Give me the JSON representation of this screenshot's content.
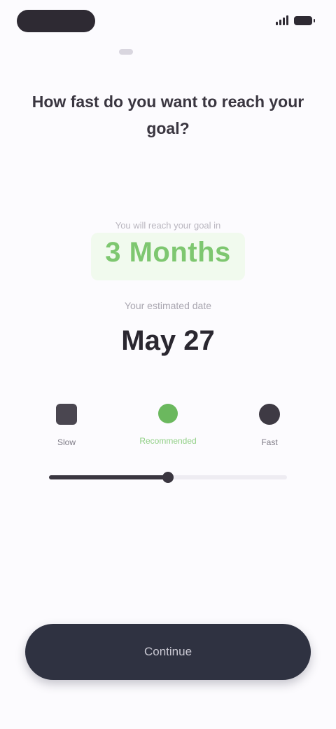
{
  "status_bar": {
    "time": "",
    "icons": [
      "signal-icon",
      "battery-icon"
    ]
  },
  "header": {
    "title": "How fast do you want to reach your goal?"
  },
  "goal": {
    "caption": "You will reach your goal in",
    "value": "3 Months",
    "accent": "#7ec770"
  },
  "target_date": {
    "caption": "Your estimated date",
    "value": "May 27"
  },
  "pace": {
    "options": [
      {
        "label": "Slow",
        "icon": "turtle-icon"
      },
      {
        "label": "Recommended",
        "icon": "rabbit-icon"
      },
      {
        "label": "Fast",
        "icon": "cheetah-icon"
      }
    ],
    "selected_index": 1,
    "fraction": 0.5
  },
  "cta": {
    "label": "Continue"
  },
  "colors": {
    "background": "#fcfbfe",
    "primary_dark": "#2f3241",
    "accent_green": "#7ec770"
  }
}
